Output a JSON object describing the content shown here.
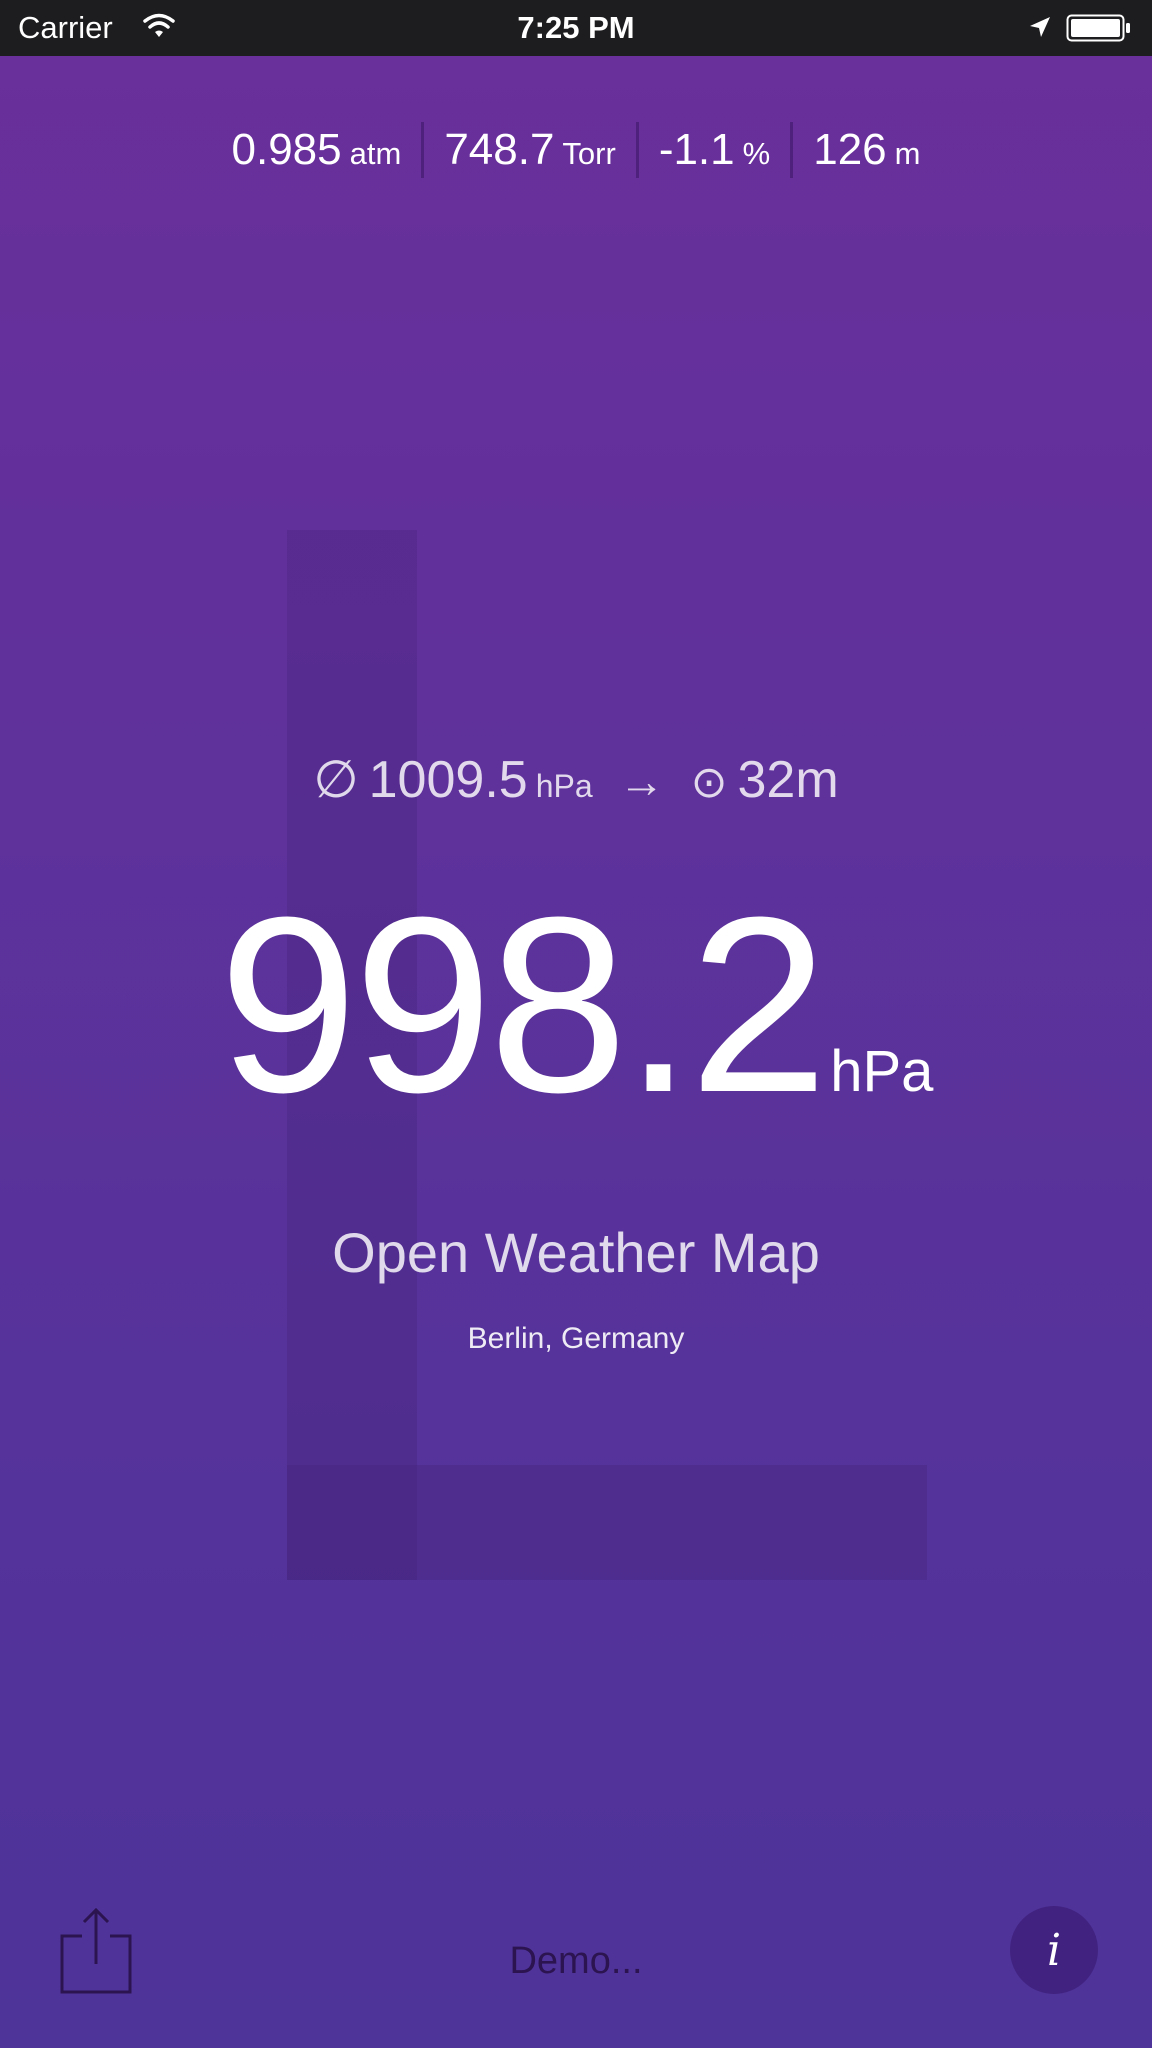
{
  "status_bar": {
    "carrier": "Carrier",
    "time": "7:25 PM"
  },
  "metrics": [
    {
      "value": "0.985",
      "unit": "atm"
    },
    {
      "value": "748.7",
      "unit": "Torr"
    },
    {
      "value": "-1.1",
      "unit": "%"
    },
    {
      "value": "126",
      "unit": "m"
    }
  ],
  "tendency": {
    "letter": "L"
  },
  "average": {
    "symbol": "∅",
    "value": "1009.5",
    "unit": "hPa",
    "arrow": "→",
    "target_symbol": "⊙",
    "distance": "32m"
  },
  "pressure": {
    "value": "998.2",
    "unit": "hPa"
  },
  "source": "Open Weather Map",
  "location": "Berlin, Germany",
  "bottom_bar": {
    "demo_label": "Demo...",
    "info_label": "i"
  },
  "icons": {
    "wifi": "wifi-icon",
    "location": "location-arrow-icon",
    "battery": "battery-icon",
    "share": "share-icon",
    "info": "info-icon"
  },
  "colors": {
    "background_top": "#6a2f9b",
    "background_bottom": "#4e3399",
    "status_bar": "#1d1d1f",
    "demo_text": "#2b1450"
  }
}
